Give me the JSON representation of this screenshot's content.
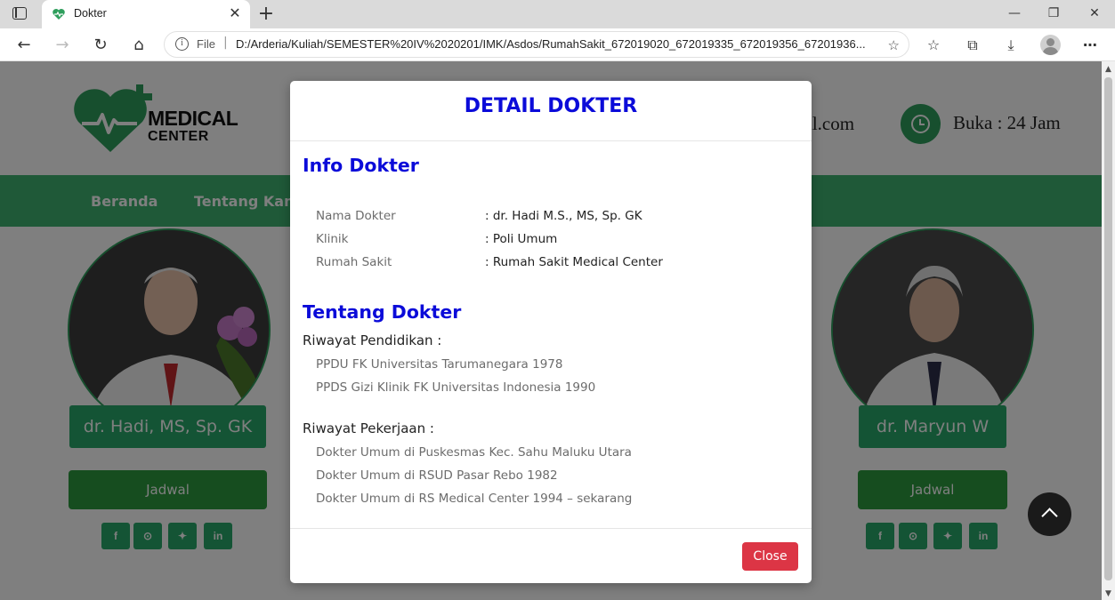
{
  "browser": {
    "tab_title": "Dokter",
    "address_scheme": "File",
    "address_url": "D:/Arderia/Kuliah/SEMESTER%20IV%2020201/IMK/Asdos/RumahSakit_672019020_672019335_672019356_67201936..."
  },
  "header": {
    "logo_line1": "MEDICAL",
    "logo_line2": "CENTER",
    "email_fragment": "il.com",
    "open_hours": "Buka : 24 Jam"
  },
  "nav": {
    "items": [
      "Beranda",
      "Tentang Kam"
    ]
  },
  "doctors": [
    {
      "name": "dr. Hadi, MS, Sp. GK",
      "schedule_label": "Jadwal"
    },
    {
      "name": "dr. Maryun W",
      "schedule_label": "Jadwal"
    }
  ],
  "social": [
    "f",
    "gh",
    "tw",
    "in"
  ],
  "modal": {
    "title": "DETAIL DOKTER",
    "info_heading": "Info Dokter",
    "info": [
      {
        "label": "Nama Dokter",
        "value": ": dr. Hadi M.S., MS, Sp. GK"
      },
      {
        "label": "Klinik",
        "value": ": Poli Umum"
      },
      {
        "label": "Rumah Sakit",
        "value": ": Rumah Sakit Medical Center"
      }
    ],
    "about_heading": "Tentang Dokter",
    "education_heading": "Riwayat Pendidikan :",
    "education": [
      "PPDU FK Universitas Tarumanegara 1978",
      "PPDS Gizi Klinik FK Universitas Indonesia 1990"
    ],
    "work_heading": "Riwayat Pekerjaan :",
    "work": [
      "Dokter Umum di Puskesmas Kec. Sahu Maluku Utara",
      "Dokter Umum di RSUD Pasar Rebo 1982",
      "Dokter Umum di RS Medical Center 1994 – sekarang"
    ],
    "close_label": "Close"
  },
  "colors": {
    "accent_blue": "#0b0bd9",
    "brand_green": "#3fb371",
    "close_red": "#dc3545"
  }
}
